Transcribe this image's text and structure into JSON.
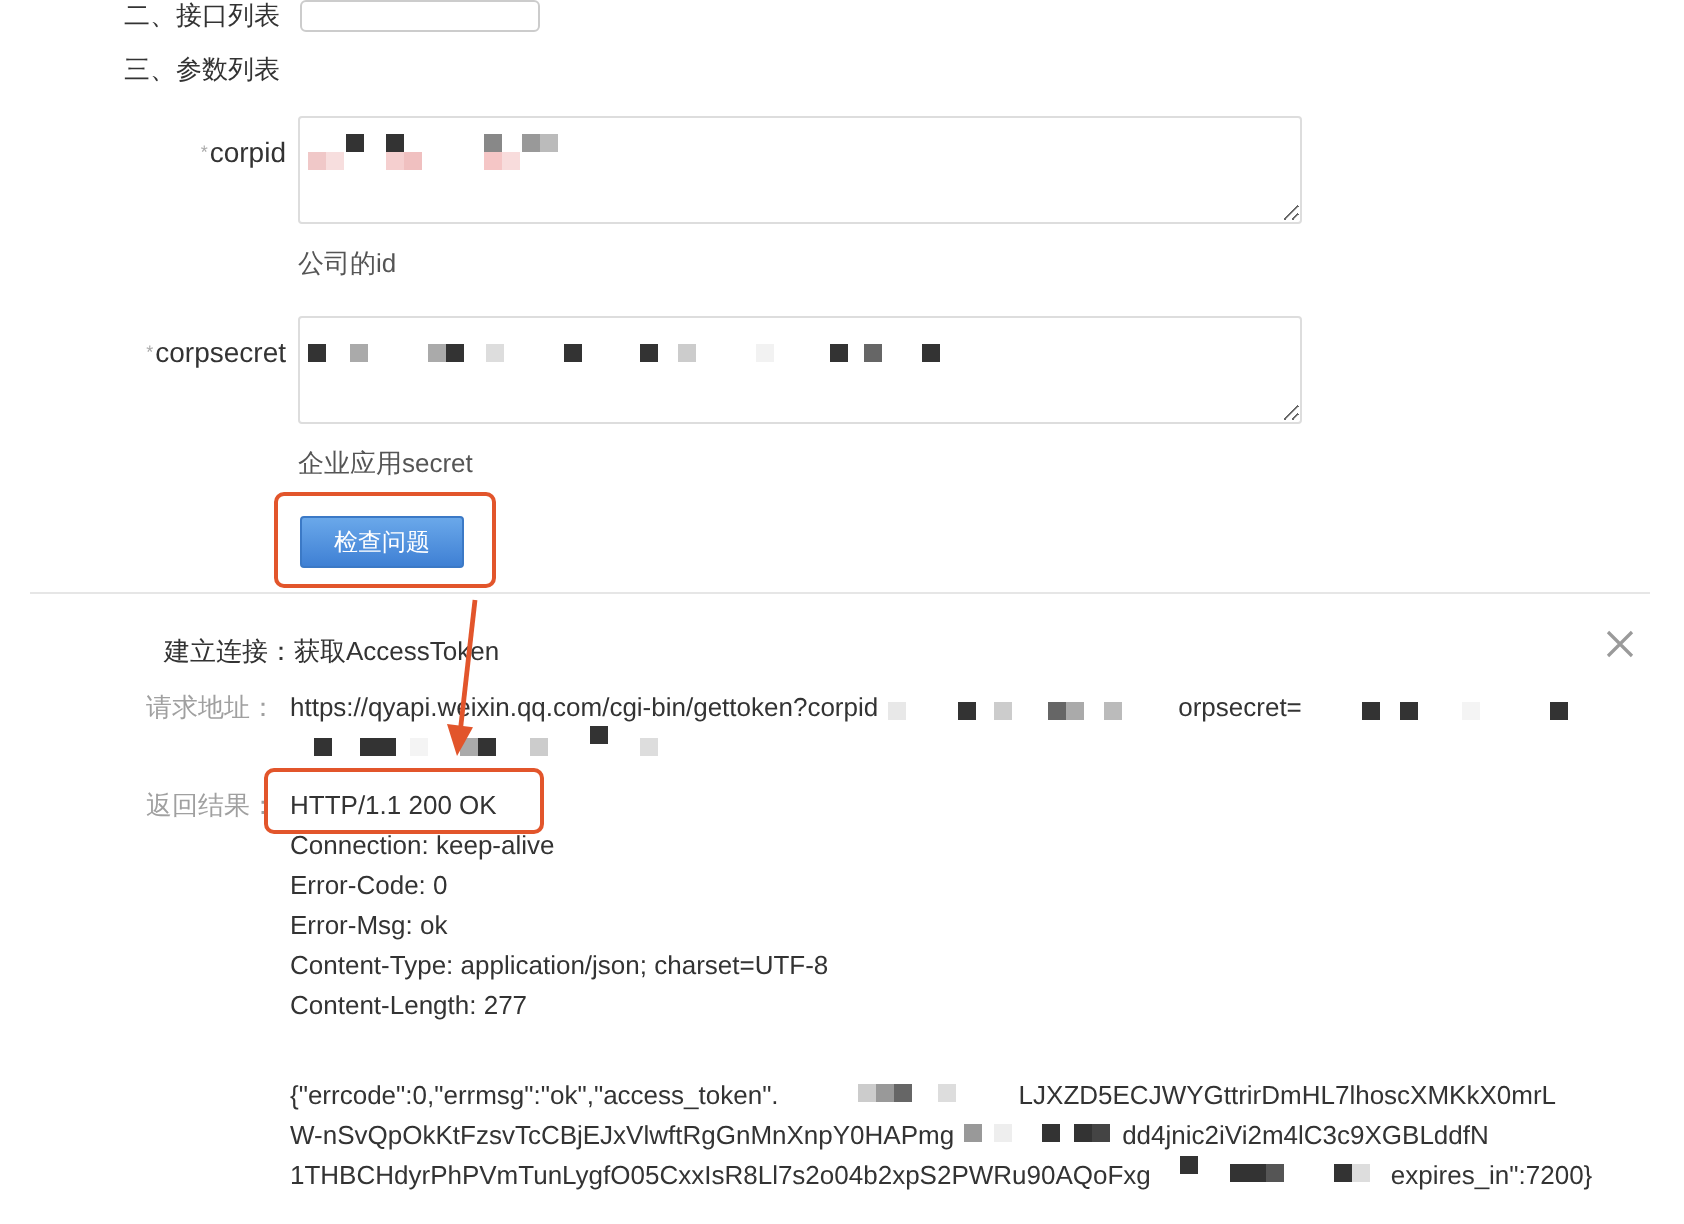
{
  "interface_list": {
    "title": "二、接口列表"
  },
  "params": {
    "title": "三、参数列表",
    "fields": [
      {
        "required_mark": "*",
        "label": "corpid",
        "hint": "公司的id"
      },
      {
        "required_mark": "*",
        "label": "corpsecret",
        "hint": "企业应用secret"
      }
    ]
  },
  "check_button": {
    "label": "检查问题",
    "highlighted": true
  },
  "result": {
    "connection": "建立连接：获取AccessToken",
    "request_label": "请求地址：",
    "request_url": [
      "https://qyapi.weixin.qq.com/cgi-bin/gettoken?corpid",
      "orpsecret="
    ],
    "response_label": "返回结果：",
    "status": {
      "text": "HTTP/1.1 200 OK",
      "highlighted": true
    },
    "headers": [
      "Connection: keep-alive",
      "Error-Code: 0",
      "Error-Msg: ok",
      "Content-Type: application/json; charset=UTF-8",
      "Content-Length: 277"
    ],
    "body_lines": [
      [
        "{\"errcode\":0,\"errmsg\":\"ok\",\"access_token\".",
        "LJXZD5ECJWYGttrirDmHL7lhoscXMKkX0mrL"
      ],
      [
        "W-nSvQpOkKtFzsvTcCBjEJxVlwftRgGnMnXnpY0HAPmg",
        "dd4jnic2iVi2m4lC3c9XGBLddfN"
      ],
      [
        "1THBCHdyrPhPVmTunLygfO05CxxIsR8Ll7s2o04b2xpS2PWRu90AQoFxg",
        "expires_in\":7200}"
      ]
    ]
  },
  "annotation_arrow": true
}
